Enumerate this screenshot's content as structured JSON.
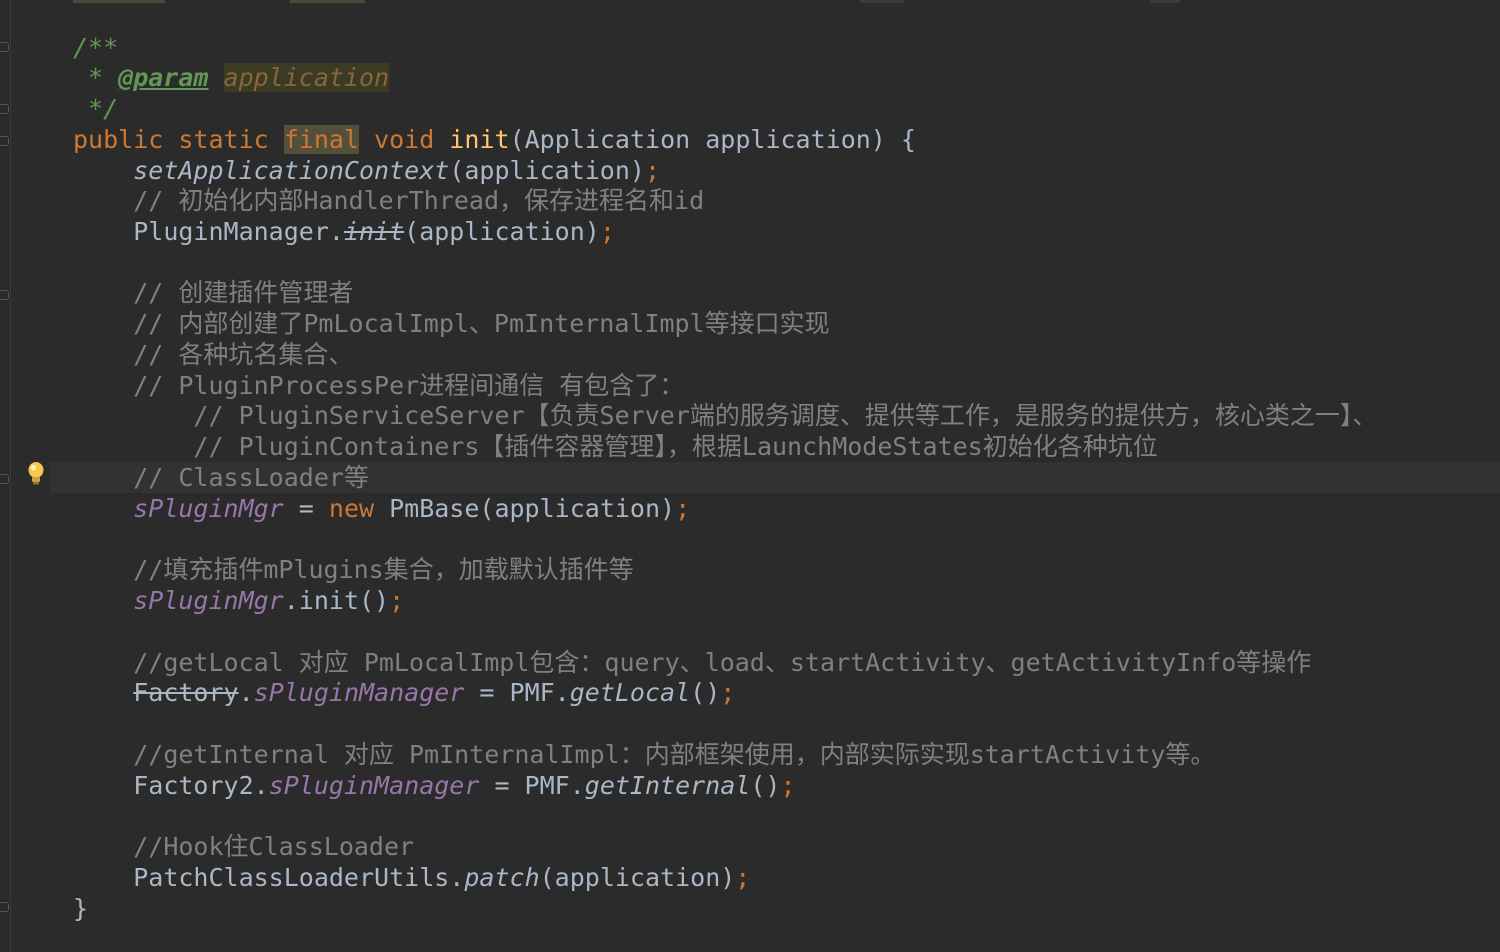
{
  "editor": {
    "language": "Java",
    "theme_colors": {
      "background": "#2b2b2b",
      "keyword": "#cc7832",
      "comment": "#808080",
      "doc_comment": "#629755",
      "method_declaration": "#ffc66d",
      "static_field": "#9876aa",
      "plain": "#a9b7c6"
    },
    "gutter_icons": [
      "bulb-icon"
    ],
    "code": {
      "doc_open": "/**",
      "doc_star": " * ",
      "doc_tag": "@param",
      "doc_param": "application",
      "doc_close": " */",
      "sig_public": "public",
      "sig_static": "static",
      "sig_final": "final",
      "sig_void": "void",
      "sig_name": "init",
      "sig_params": "(Application application) {",
      "l1_call": "setApplicationContext",
      "l1_args": "(application)",
      "semi": ";",
      "c1": "// 初始化内部HandlerThread，保存进程名和id",
      "l3_class": "PluginManager.",
      "l3_method": "init",
      "l3_args": "(application)",
      "c2": "// 创建插件管理者",
      "c3": "// 内部创建了PmLocalImpl、PmInternalImpl等接口实现",
      "c4": "// 各种坑名集合、",
      "c5": "// PluginProcessPer进程间通信 有包含了：",
      "c6": "// PluginServiceServer【负责Server端的服务调度、提供等工作，是服务的提供方，核心类之一】、",
      "c7": "// PluginContainers【插件容器管理】，根据LaunchModeStates初始化各种坑位",
      "c8": "// ClassLoader等",
      "l5_field": "sPluginMgr",
      "l5_assign": " = ",
      "l5_new": "new",
      "l5_rest": " PmBase(application)",
      "c9": "//填充插件mPlugins集合，加载默认插件等",
      "l6_field": "sPluginMgr",
      "l6_rest": ".init()",
      "c10": "//getLocal 对应 PmLocalImpl包含：query、load、startActivity、getActivityInfo等操作",
      "l7_class": "Factory",
      "l7_dot": ".",
      "l7_field": "sPluginManager",
      "l7_assign": " = PMF.",
      "l7_method": "getLocal",
      "l7_paren": "()",
      "c11": "//getInternal 对应 PmInternalImpl：内部框架使用，内部实际实现startActivity等。",
      "l8_class": "Factory2.",
      "l8_field": "sPluginManager",
      "l8_assign": " = PMF.",
      "l8_method": "getInternal",
      "l8_paren": "()",
      "c12": "//Hook住ClassLoader",
      "l9_class": "PatchClassLoaderUtils.",
      "l9_method": "patch",
      "l9_args": "(application)",
      "close_brace": "}"
    }
  }
}
